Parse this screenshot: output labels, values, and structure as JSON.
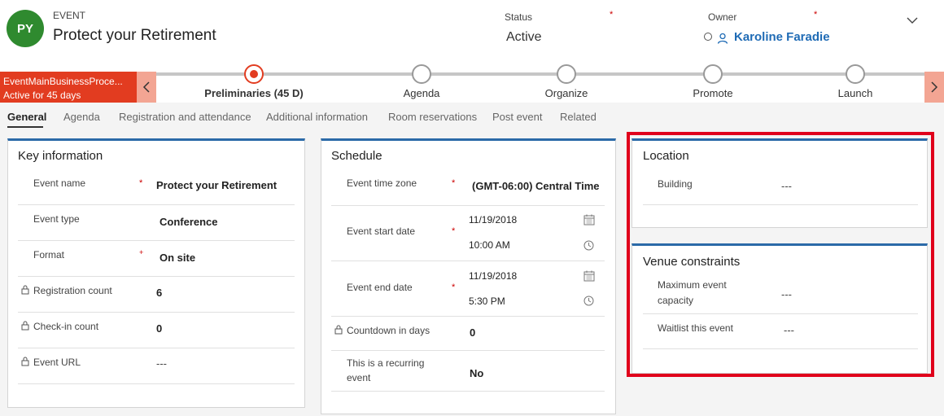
{
  "header": {
    "avatar_initials": "PY",
    "entity_type": "EVENT",
    "title": "Protect your Retirement",
    "status_label": "Status",
    "status_value": "Active",
    "owner_label": "Owner",
    "owner_value": "Karoline Faradie",
    "required_marker": "*"
  },
  "bpf": {
    "active_process": "EventMainBusinessProce...",
    "active_duration": "Active for 45 days",
    "stages": [
      {
        "label": "Preliminaries  (45 D)",
        "current": true
      },
      {
        "label": "Agenda",
        "current": false
      },
      {
        "label": "Organize",
        "current": false
      },
      {
        "label": "Promote",
        "current": false
      },
      {
        "label": "Launch",
        "current": false
      }
    ]
  },
  "tabs": [
    "General",
    "Agenda",
    "Registration and attendance",
    "Additional information",
    "Room reservations",
    "Post event",
    "Related"
  ],
  "key_information": {
    "title": "Key information",
    "fields": [
      {
        "label": "Event name",
        "value": "Protect your Retirement"
      },
      {
        "label": "Event type",
        "value": "Conference"
      },
      {
        "label": "Format",
        "value": "On site"
      },
      {
        "label": "Registration count",
        "value": "6"
      },
      {
        "label": "Check-in count",
        "value": "0"
      },
      {
        "label": "Event URL",
        "value": "---"
      }
    ]
  },
  "schedule": {
    "title": "Schedule",
    "time_zone_label": "Event time zone",
    "time_zone_value": "(GMT-06:00) Central Time (",
    "start_label": "Event start date",
    "start_date": "11/19/2018",
    "start_time": "10:00 AM",
    "end_label": "Event end date",
    "end_date": "11/19/2018",
    "end_time": "5:30 PM",
    "countdown_label": "Countdown in days",
    "countdown_value": "0",
    "recurring_label_line1": "This is a recurring",
    "recurring_label_line2": "event",
    "recurring_value": "No"
  },
  "location": {
    "title": "Location",
    "building_label": "Building",
    "building_value": "---"
  },
  "venue": {
    "title": "Venue constraints",
    "capacity_label_line1": "Maximum event",
    "capacity_label_line2": "capacity",
    "capacity_value": "---",
    "waitlist_label": "Waitlist this event",
    "waitlist_value": "---"
  },
  "colors": {
    "accent": "#2b6aa8",
    "bpf_active": "#e23c20",
    "highlight": "#e0001b",
    "avatar": "#2f8a2f"
  }
}
